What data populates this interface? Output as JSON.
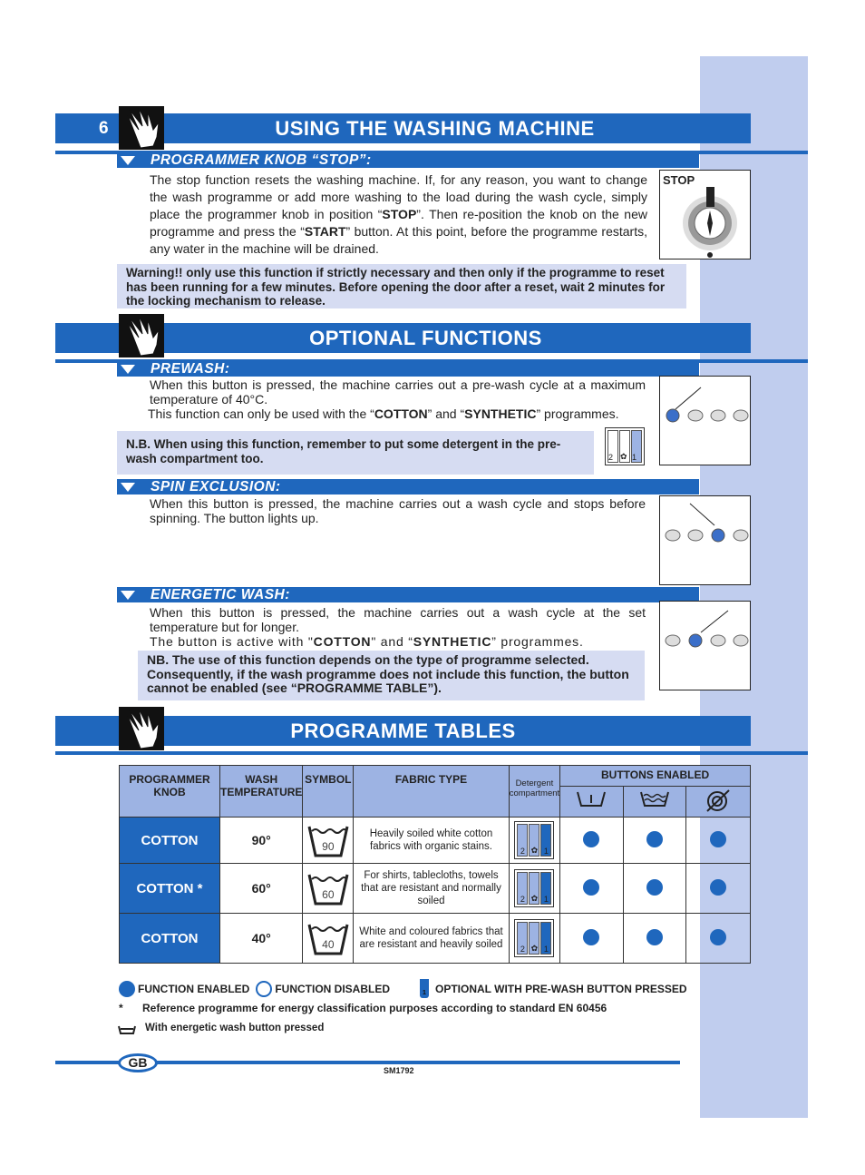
{
  "page_number": "6",
  "sections": {
    "using": {
      "title": "USING THE WASHING MACHINE"
    },
    "optional": {
      "title": "OPTIONAL FUNCTIONS"
    },
    "tables": {
      "title": "PROGRAMME TABLES"
    }
  },
  "stop": {
    "heading": "PROGRAMMER KNOB “STOP”:",
    "p1": "The stop function resets the washing machine. If, for any reason, you want to change the wash programme or add more washing to the load during the wash cycle, simply place the programmer knob in position “",
    "b1": "STOP",
    "p2": "”. Then re-position the knob on the new programme and press the “",
    "b2": "START",
    "p3": "” button. At this point, before the programme restarts, any water in the machine will be drained.",
    "image_label": "STOP",
    "warning": "Warning!! only use this function if strictly necessary and then only if the programme to reset has been running for a few minutes. Before opening the door after a reset, wait 2 minutes for the locking mechanism to release."
  },
  "prewash": {
    "heading": "PREWASH:",
    "p1": "When this button is pressed, the machine carries out a pre-wash cycle at a maximum temperature of 40°C.",
    "p2a": "This function can only be used with the “",
    "b1": "COTTON",
    "p2b": "” and “",
    "b2": "SYNTHETIC",
    "p2c": "” programmes.",
    "note": "N.B. When using this function, remember to put some detergent in the pre-wash compartment too."
  },
  "spin": {
    "heading": "SPIN EXCLUSION:",
    "p1": "When this button is pressed, the machine carries out a wash cycle and stops before spinning. The button lights up."
  },
  "energetic": {
    "heading": "ENERGETIC WASH:",
    "p1": "When this button is pressed, the machine carries out a wash cycle at the set temperature but for longer.",
    "p2a": "The button is active with \"",
    "b1": "COTTON",
    "p2b": "\" and “",
    "b2": "SYNTHETIC",
    "p2c": "” programmes.",
    "note": "NB. The use of this function depends on the type of programme selected. Consequently, if the wash programme does not include this function, the button cannot be enabled (see “PROGRAMME TABLE”)."
  },
  "compartment_labels": [
    "2",
    "✿",
    "1"
  ],
  "table": {
    "headers": {
      "knob": "PROGRAMMER KNOB",
      "temp": "WASH TEMPERATURE",
      "symbol": "SYMBOL",
      "fabric": "FABRIC TYPE",
      "detergent": "Detergent compartment",
      "buttons": "BUTTONS ENABLED"
    },
    "button_icons": [
      "prewash-icon",
      "energetic-wash-icon",
      "spin-exclusion-icon"
    ],
    "rows": [
      {
        "knob": "COTTON",
        "temp": "90°",
        "symbol": "90",
        "fabric": "Heavily soiled white cotton fabrics with organic stains.",
        "buttons": [
          true,
          true,
          true
        ]
      },
      {
        "knob": "COTTON *",
        "temp": "60°",
        "symbol": "60",
        "fabric": "For shirts, tablecloths, towels that are resistant and normally soiled",
        "buttons": [
          true,
          true,
          true
        ]
      },
      {
        "knob": "COTTON",
        "temp": "40°",
        "symbol": "40",
        "fabric": "White and coloured fabrics that are resistant and heavily soiled",
        "buttons": [
          true,
          true,
          true
        ]
      }
    ]
  },
  "legend": {
    "enabled": "FUNCTION ENABLED",
    "disabled": "FUNCTION DISABLED",
    "optional": "OPTIONAL WITH PRE-WASH BUTTON PRESSED",
    "optional_num": "1",
    "asterisk": "*",
    "reference": "Reference programme for energy classification purposes according to standard EN 60456",
    "energetic": "With energetic wash button pressed"
  },
  "footer": {
    "lang": "GB",
    "code": "SM1792"
  },
  "colors": {
    "accent": "#1f67bd",
    "light": "#c0cdee",
    "note_bg": "#d6dcf2",
    "header_bg": "#9db3e3"
  }
}
